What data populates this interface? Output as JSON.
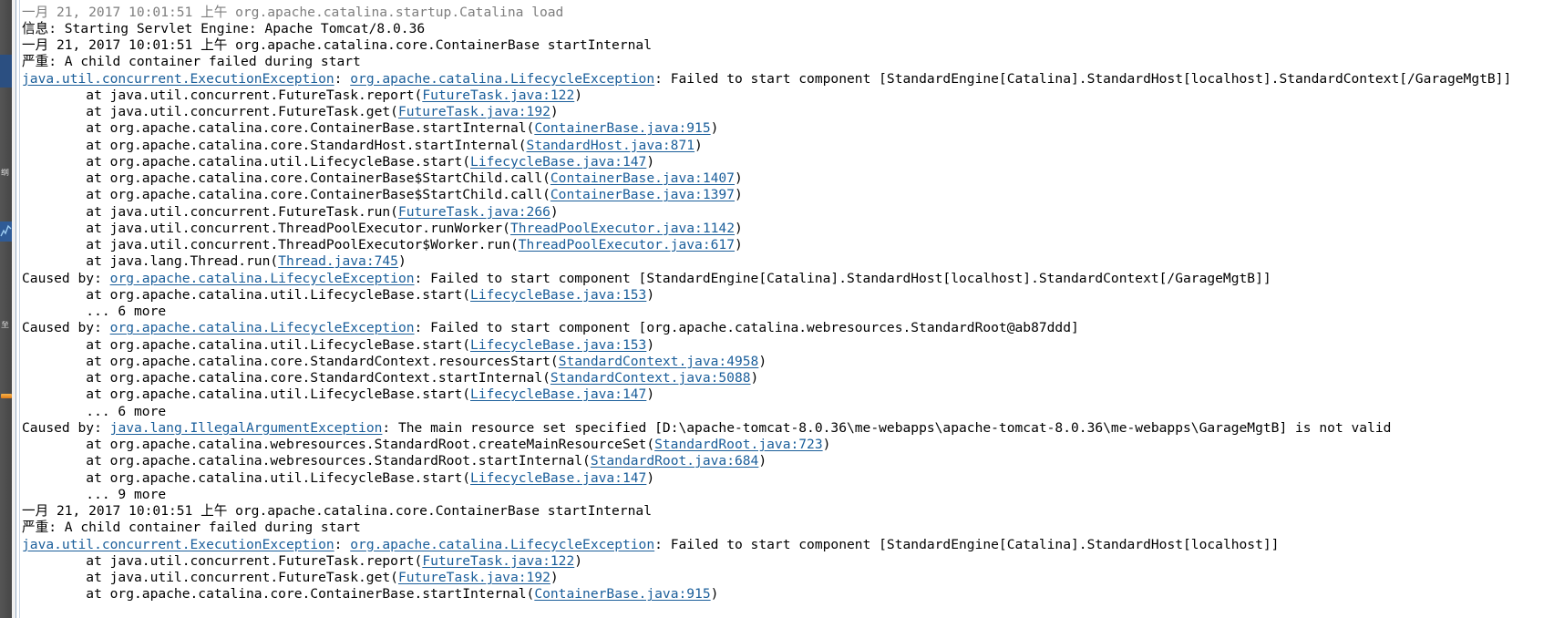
{
  "window": {
    "type": "ide-console-view",
    "app": "Eclipse IDE Console",
    "background_color": "#ffffff",
    "text_color": "#000000",
    "link_color": "#1a5e9a",
    "rail_color": "#4a4a4a",
    "rail_accent_color": "#2b4f81"
  },
  "ide_rail": {
    "items": [
      {
        "name": "perspective-tab-active",
        "label": ""
      },
      {
        "name": "outline-label",
        "label": "纲"
      },
      {
        "name": "chart-icon",
        "label": ""
      },
      {
        "name": "console-label",
        "label": "至"
      },
      {
        "name": "bookmark-icon",
        "label": ""
      }
    ]
  },
  "console": {
    "name": "tomcat-startup-log",
    "font_size_px": 14.6,
    "line_height_px": 18.25,
    "lines": [
      {
        "id": 0,
        "clipped": true,
        "segments": [
          {
            "text": "一月 21, 2017 10:01:51 上午 org.apache.catalina.startup.Catalina load",
            "style": "plain"
          }
        ]
      },
      {
        "id": 1,
        "segments": [
          {
            "text": "信息: Starting Servlet Engine: Apache Tomcat/8.0.36",
            "style": "plain"
          }
        ]
      },
      {
        "id": 2,
        "segments": [
          {
            "text": "一月 21, 2017 10:01:51 上午 org.apache.catalina.core.ContainerBase startInternal",
            "style": "plain"
          }
        ]
      },
      {
        "id": 3,
        "segments": [
          {
            "text": "严重: A child container failed during start",
            "style": "plain"
          }
        ]
      },
      {
        "id": 4,
        "segments": [
          {
            "text": "java.util.concurrent.ExecutionException",
            "style": "link"
          },
          {
            "text": ": ",
            "style": "plain"
          },
          {
            "text": "org.apache.catalina.LifecycleException",
            "style": "link"
          },
          {
            "text": ": Failed to start component [StandardEngine[Catalina].StandardHost[localhost].StandardContext[/GarageMgtB]]",
            "style": "plain"
          }
        ]
      },
      {
        "id": 5,
        "segments": [
          {
            "text": "        at java.util.concurrent.FutureTask.report(",
            "style": "plain"
          },
          {
            "text": "FutureTask.java:122",
            "style": "link"
          },
          {
            "text": ")",
            "style": "plain"
          }
        ]
      },
      {
        "id": 6,
        "segments": [
          {
            "text": "        at java.util.concurrent.FutureTask.get(",
            "style": "plain"
          },
          {
            "text": "FutureTask.java:192",
            "style": "link"
          },
          {
            "text": ")",
            "style": "plain"
          }
        ]
      },
      {
        "id": 7,
        "segments": [
          {
            "text": "        at org.apache.catalina.core.ContainerBase.startInternal(",
            "style": "plain"
          },
          {
            "text": "ContainerBase.java:915",
            "style": "link"
          },
          {
            "text": ")",
            "style": "plain"
          }
        ]
      },
      {
        "id": 8,
        "segments": [
          {
            "text": "        at org.apache.catalina.core.StandardHost.startInternal(",
            "style": "plain"
          },
          {
            "text": "StandardHost.java:871",
            "style": "link"
          },
          {
            "text": ")",
            "style": "plain"
          }
        ]
      },
      {
        "id": 9,
        "segments": [
          {
            "text": "        at org.apache.catalina.util.LifecycleBase.start(",
            "style": "plain"
          },
          {
            "text": "LifecycleBase.java:147",
            "style": "link"
          },
          {
            "text": ")",
            "style": "plain"
          }
        ]
      },
      {
        "id": 10,
        "segments": [
          {
            "text": "        at org.apache.catalina.core.ContainerBase$StartChild.call(",
            "style": "plain"
          },
          {
            "text": "ContainerBase.java:1407",
            "style": "link"
          },
          {
            "text": ")",
            "style": "plain"
          }
        ]
      },
      {
        "id": 11,
        "segments": [
          {
            "text": "        at org.apache.catalina.core.ContainerBase$StartChild.call(",
            "style": "plain"
          },
          {
            "text": "ContainerBase.java:1397",
            "style": "link"
          },
          {
            "text": ")",
            "style": "plain"
          }
        ]
      },
      {
        "id": 12,
        "segments": [
          {
            "text": "        at java.util.concurrent.FutureTask.run(",
            "style": "plain"
          },
          {
            "text": "FutureTask.java:266",
            "style": "link"
          },
          {
            "text": ")",
            "style": "plain"
          }
        ]
      },
      {
        "id": 13,
        "segments": [
          {
            "text": "        at java.util.concurrent.ThreadPoolExecutor.runWorker(",
            "style": "plain"
          },
          {
            "text": "ThreadPoolExecutor.java:1142",
            "style": "link"
          },
          {
            "text": ")",
            "style": "plain"
          }
        ]
      },
      {
        "id": 14,
        "segments": [
          {
            "text": "        at java.util.concurrent.ThreadPoolExecutor$Worker.run(",
            "style": "plain"
          },
          {
            "text": "ThreadPoolExecutor.java:617",
            "style": "link"
          },
          {
            "text": ")",
            "style": "plain"
          }
        ]
      },
      {
        "id": 15,
        "segments": [
          {
            "text": "        at java.lang.Thread.run(",
            "style": "plain"
          },
          {
            "text": "Thread.java:745",
            "style": "link"
          },
          {
            "text": ")",
            "style": "plain"
          }
        ]
      },
      {
        "id": 16,
        "segments": [
          {
            "text": "Caused by: ",
            "style": "plain"
          },
          {
            "text": "org.apache.catalina.LifecycleException",
            "style": "link"
          },
          {
            "text": ": Failed to start component [StandardEngine[Catalina].StandardHost[localhost].StandardContext[/GarageMgtB]]",
            "style": "plain"
          }
        ]
      },
      {
        "id": 17,
        "segments": [
          {
            "text": "        at org.apache.catalina.util.LifecycleBase.start(",
            "style": "plain"
          },
          {
            "text": "LifecycleBase.java:153",
            "style": "link"
          },
          {
            "text": ")",
            "style": "plain"
          }
        ]
      },
      {
        "id": 18,
        "segments": [
          {
            "text": "        ... 6 more",
            "style": "plain"
          }
        ]
      },
      {
        "id": 19,
        "segments": [
          {
            "text": "Caused by: ",
            "style": "plain"
          },
          {
            "text": "org.apache.catalina.LifecycleException",
            "style": "link"
          },
          {
            "text": ": Failed to start component [org.apache.catalina.webresources.StandardRoot@ab87ddd]",
            "style": "plain"
          }
        ]
      },
      {
        "id": 20,
        "segments": [
          {
            "text": "        at org.apache.catalina.util.LifecycleBase.start(",
            "style": "plain"
          },
          {
            "text": "LifecycleBase.java:153",
            "style": "link"
          },
          {
            "text": ")",
            "style": "plain"
          }
        ]
      },
      {
        "id": 21,
        "segments": [
          {
            "text": "        at org.apache.catalina.core.StandardContext.resourcesStart(",
            "style": "plain"
          },
          {
            "text": "StandardContext.java:4958",
            "style": "link"
          },
          {
            "text": ")",
            "style": "plain"
          }
        ]
      },
      {
        "id": 22,
        "segments": [
          {
            "text": "        at org.apache.catalina.core.StandardContext.startInternal(",
            "style": "plain"
          },
          {
            "text": "StandardContext.java:5088",
            "style": "link"
          },
          {
            "text": ")",
            "style": "plain"
          }
        ]
      },
      {
        "id": 23,
        "segments": [
          {
            "text": "        at org.apache.catalina.util.LifecycleBase.start(",
            "style": "plain"
          },
          {
            "text": "LifecycleBase.java:147",
            "style": "link"
          },
          {
            "text": ")",
            "style": "plain"
          }
        ]
      },
      {
        "id": 24,
        "segments": [
          {
            "text": "        ... 6 more",
            "style": "plain"
          }
        ]
      },
      {
        "id": 25,
        "segments": [
          {
            "text": "Caused by: ",
            "style": "plain"
          },
          {
            "text": "java.lang.IllegalArgumentException",
            "style": "link"
          },
          {
            "text": ": The main resource set specified [D:\\apache-tomcat-8.0.36\\me-webapps\\apache-tomcat-8.0.36\\me-webapps\\GarageMgtB] is not valid",
            "style": "plain"
          }
        ]
      },
      {
        "id": 26,
        "segments": [
          {
            "text": "        at org.apache.catalina.webresources.StandardRoot.createMainResourceSet(",
            "style": "plain"
          },
          {
            "text": "StandardRoot.java:723",
            "style": "link"
          },
          {
            "text": ")",
            "style": "plain"
          }
        ]
      },
      {
        "id": 27,
        "segments": [
          {
            "text": "        at org.apache.catalina.webresources.StandardRoot.startInternal(",
            "style": "plain"
          },
          {
            "text": "StandardRoot.java:684",
            "style": "link"
          },
          {
            "text": ")",
            "style": "plain"
          }
        ]
      },
      {
        "id": 28,
        "segments": [
          {
            "text": "        at org.apache.catalina.util.LifecycleBase.start(",
            "style": "plain"
          },
          {
            "text": "LifecycleBase.java:147",
            "style": "link"
          },
          {
            "text": ")",
            "style": "plain"
          }
        ]
      },
      {
        "id": 29,
        "segments": [
          {
            "text": "        ... 9 more",
            "style": "plain"
          }
        ]
      },
      {
        "id": 30,
        "segments": [
          {
            "text": "一月 21, 2017 10:01:51 上午 org.apache.catalina.core.ContainerBase startInternal",
            "style": "plain"
          }
        ]
      },
      {
        "id": 31,
        "segments": [
          {
            "text": "严重: A child container failed during start",
            "style": "plain"
          }
        ]
      },
      {
        "id": 32,
        "segments": [
          {
            "text": "java.util.concurrent.ExecutionException",
            "style": "link"
          },
          {
            "text": ": ",
            "style": "plain"
          },
          {
            "text": "org.apache.catalina.LifecycleException",
            "style": "link"
          },
          {
            "text": ": Failed to start component [StandardEngine[Catalina].StandardHost[localhost]]",
            "style": "plain"
          }
        ]
      },
      {
        "id": 33,
        "segments": [
          {
            "text": "        at java.util.concurrent.FutureTask.report(",
            "style": "plain"
          },
          {
            "text": "FutureTask.java:122",
            "style": "link"
          },
          {
            "text": ")",
            "style": "plain"
          }
        ]
      },
      {
        "id": 34,
        "segments": [
          {
            "text": "        at java.util.concurrent.FutureTask.get(",
            "style": "plain"
          },
          {
            "text": "FutureTask.java:192",
            "style": "link"
          },
          {
            "text": ")",
            "style": "plain"
          }
        ]
      },
      {
        "id": 35,
        "segments": [
          {
            "text": "        at org.apache.catalina.core.ContainerBase.startInternal(",
            "style": "plain"
          },
          {
            "text": "ContainerBase.java:915",
            "style": "link"
          },
          {
            "text": ")",
            "style": "plain"
          }
        ]
      }
    ]
  }
}
